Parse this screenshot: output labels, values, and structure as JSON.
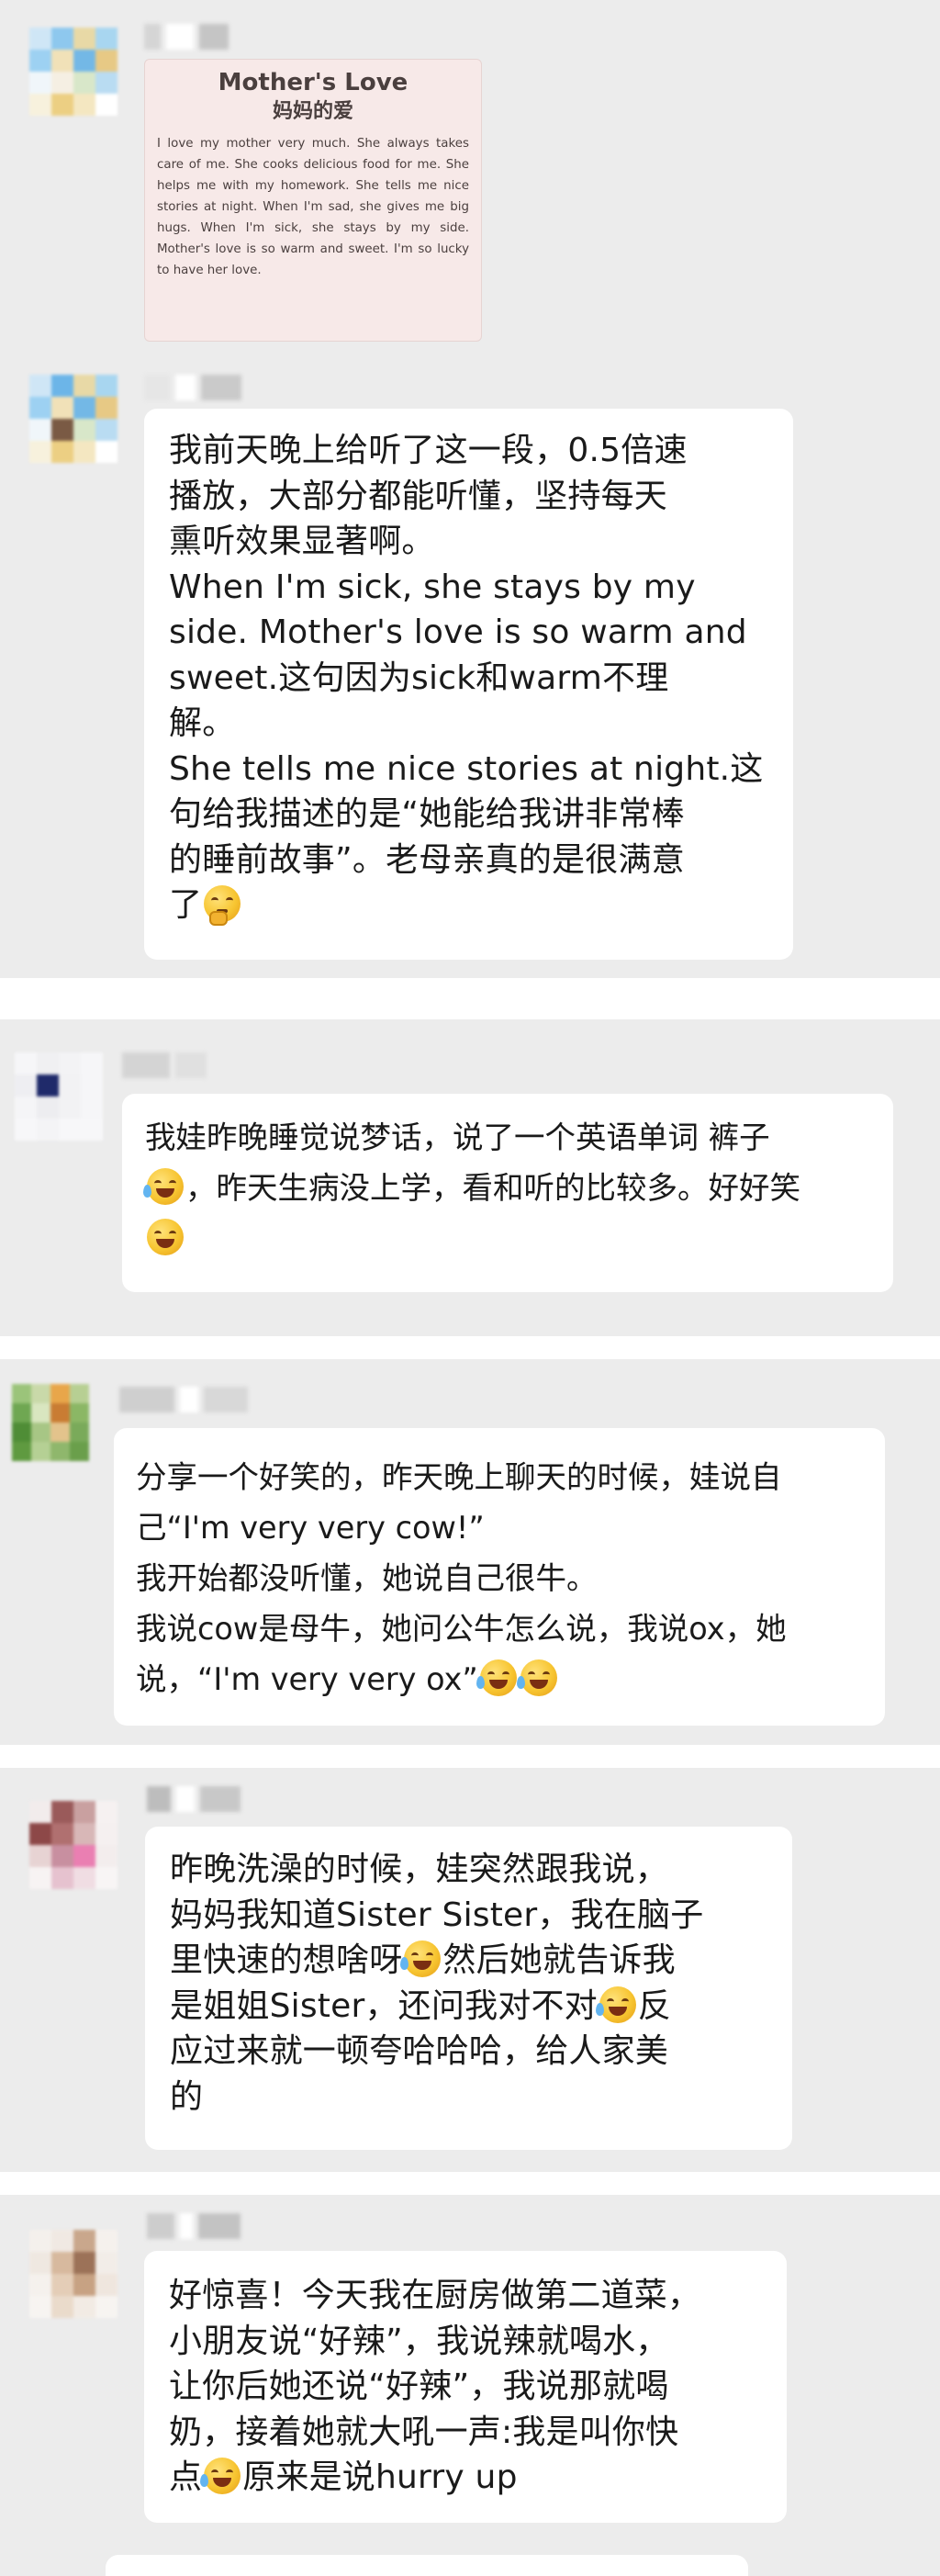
{
  "messages": [
    {
      "poster": {
        "title": "Mother's Love",
        "subtitle": "妈妈的爱",
        "body": "I love my mother very much. She always takes care of me. She cooks delicious food for me. She helps me with my homework. She tells me nice stories at night. When I'm sad, she gives me big hugs. When I'm sick, she stays by my side. Mother's love is so warm and sweet. I'm so lucky to have her love."
      }
    },
    {
      "lines": [
        "我前天晚上给听了这一段，0.5倍速",
        "播放，大部分都能听懂，坚持每天",
        "熏听效果显著啊。",
        "When I'm sick, she stays by my",
        "side. Mother's love is so warm and",
        "sweet.这句因为sick和warm不理",
        "解。",
        "She tells me nice stories at night.这",
        "句给我描述的是“她能给我讲非常棒",
        "的睡前故事”。老母亲真的是很满意",
        "了"
      ],
      "emoji": "thinking-face"
    },
    {
      "lines": [
        "我娃昨晚睡觉说梦话，说了一个英语单词 裤子",
        "，昨天生病没上学，看和听的比较多。好好笑",
        ""
      ],
      "emoji": [
        "loudly-crying-laughing-face",
        "grinning-squinting-face"
      ]
    },
    {
      "lines": [
        "分享一个好笑的，昨天晚上聊天的时候，娃说自",
        "己“I'm very very cow!”",
        "我开始都没听懂，她说自己很牛。",
        "我说cow是母牛，她问公牛怎么说，我说ox，她",
        "说，“I'm very very ox”"
      ],
      "emoji": [
        "tears-of-joy-face",
        "tears-of-joy-face"
      ]
    },
    {
      "lines": [
        "昨晚洗澡的时候，娃突然跟我说，",
        "妈妈我知道Sister Sister，我在脑子",
        "里快速的想啥呀",
        "然后她就告诉我",
        "是姐姐Sister，还问我对不对",
        "反",
        "应过来就一顿夸哈哈哈，给人家美",
        "的"
      ],
      "emoji": [
        "loudly-crying-laughing-face",
        "tears-of-joy-face"
      ]
    },
    {
      "lines": [
        "好惊喜！今天我在厨房做第二道菜，",
        "小朋友说“好辣”，我说辣就喝水，",
        "让你后她还说“好辣”，我说那就喝",
        "奶，接着她就大吼一声:我是叫你快",
        "点",
        "原来是说hurry up"
      ],
      "emoji": "loudly-crying-laughing-face"
    }
  ],
  "colors": {
    "background": "#ececec",
    "bubble": "#ffffff",
    "text": "#1a1a1a",
    "poster_bg": "#f7e9e8"
  }
}
